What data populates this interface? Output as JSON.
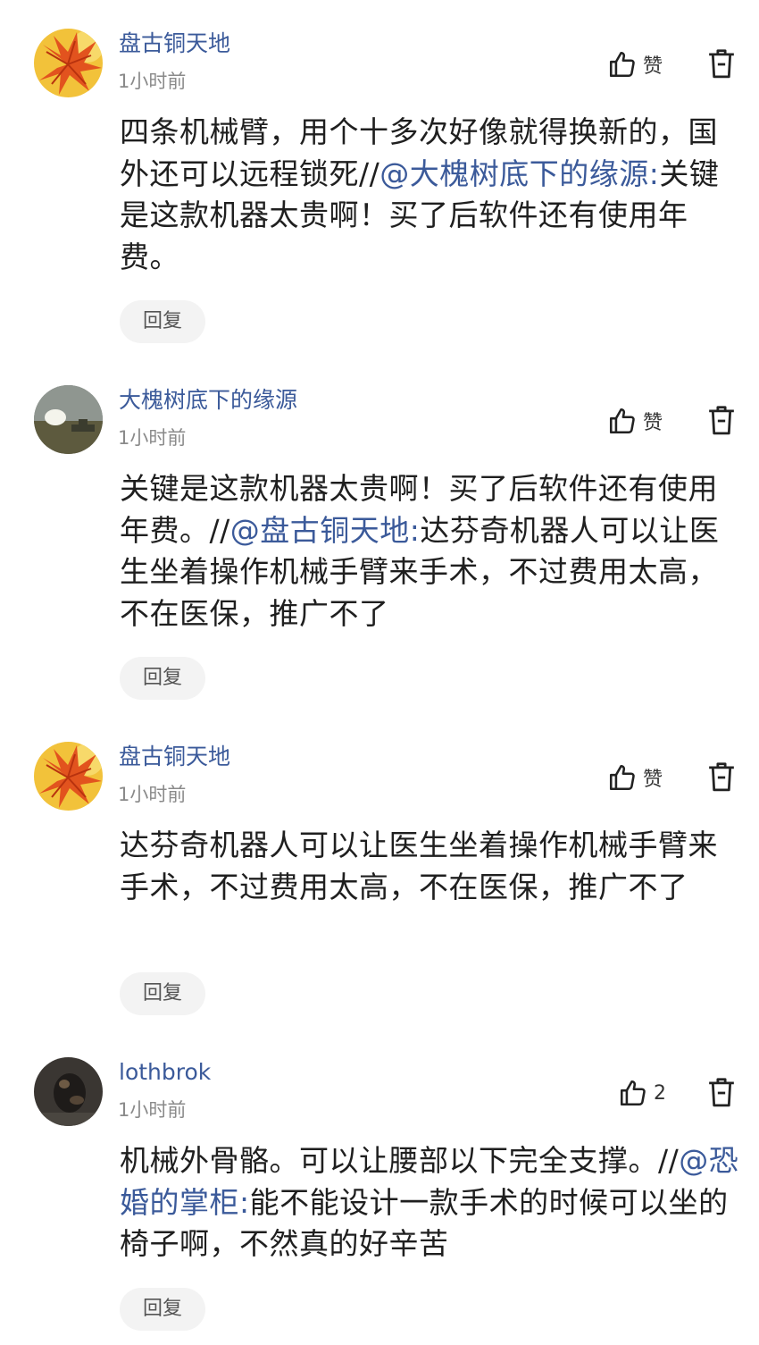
{
  "comments": [
    {
      "username": "盘古铜天地",
      "time": "1小时前",
      "like_label": "赞",
      "avatar": "maple-leaf-avatar",
      "body_before": "四条机械臂，用个十多次好像就得换新的，国外还可以远程锁死//",
      "mention": "@大槐树底下的缘源:",
      "body_after": "关键是这款机器太贵啊！买了后软件还有使用年费。",
      "reply_label": "回复"
    },
    {
      "username": "大槐树底下的缘源",
      "time": "1小时前",
      "like_label": "赞",
      "avatar": "landscape-avatar",
      "body_before": "关键是这款机器太贵啊！买了后软件还有使用年费。//",
      "mention": "@盘古铜天地:",
      "body_after": "达芬奇机器人可以让医生坐着操作机械手臂来手术，不过费用太高，不在医保，推广不了",
      "reply_label": "回复"
    },
    {
      "username": "盘古铜天地",
      "time": "1小时前",
      "like_label": "赞",
      "avatar": "maple-leaf-avatar",
      "body_before": "达芬奇机器人可以让医生坐着操作机械手臂来手术，不过费用太高，不在医保，推广不了",
      "mention": "",
      "body_after": "",
      "reply_label": "回复"
    },
    {
      "username": "lothbrok",
      "time": "1小时前",
      "like_label": "2",
      "avatar": "dark-photo-avatar",
      "body_before": "机械外骨骼。可以让腰部以下完全支撑。//",
      "mention": "@恐婚的掌柜:",
      "body_after": "能不能设计一款手术的时候可以坐的椅子啊，不然真的好辛苦",
      "reply_label": "回复"
    }
  ],
  "colors": {
    "username": "#3b5a9a",
    "mention": "#3b5a9a",
    "timestamp": "#8a8a8a",
    "reply_bg": "#f3f3f3"
  },
  "icons": {
    "like": "thumbs-up-icon",
    "delete": "trash-icon"
  }
}
